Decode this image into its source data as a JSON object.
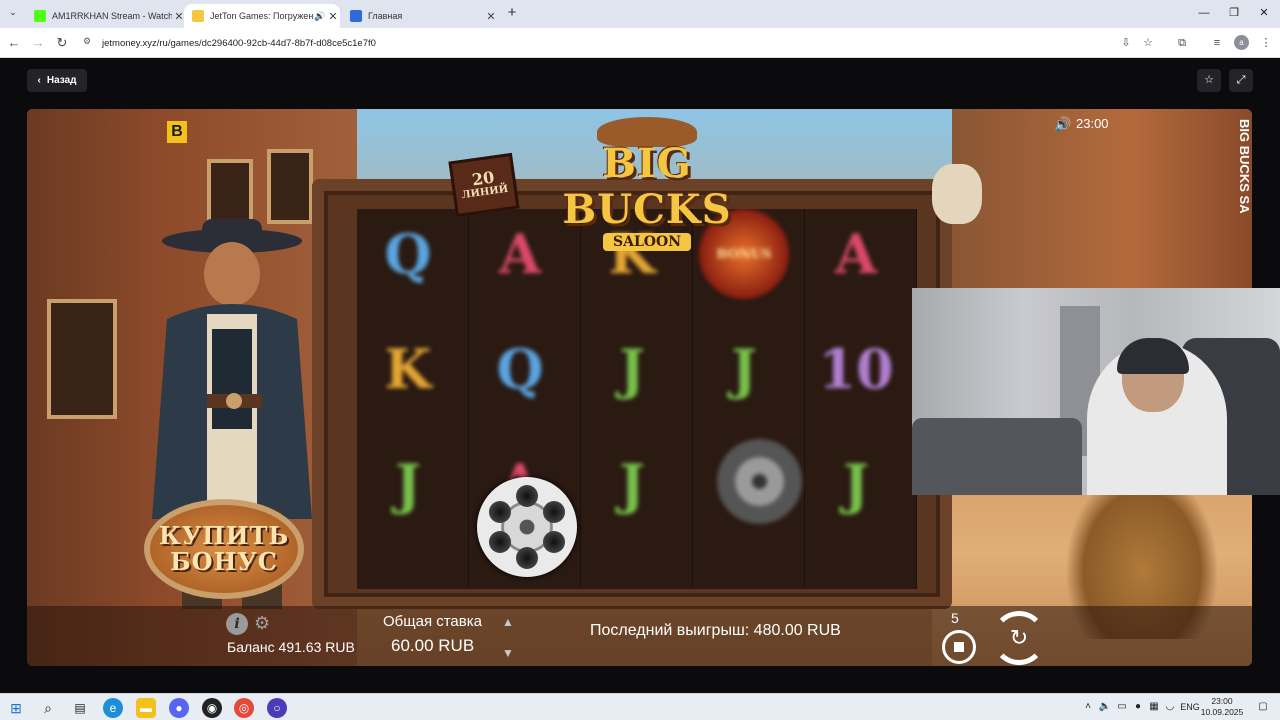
{
  "browser": {
    "tabs": [
      {
        "label": "AM1RRKHAN Stream - Watch l",
        "favicon": "kick-icon",
        "color": "#1a1a1a"
      },
      {
        "label": "JetTon Games: Погружени",
        "favicon": "jetton-icon",
        "color": "#4a8f1f"
      },
      {
        "label": "Главная",
        "favicon": "app-icon",
        "color": "#2e6bd8"
      }
    ],
    "url": "jetmoney.xyz/ru/games/dc296400-92cb-44d7-8b7f-d08ce5c1e7f0",
    "profile_initial": "a"
  },
  "page": {
    "back_label": "Назад",
    "favorite_icon": "star-icon",
    "fullscreen_icon": "expand-icon"
  },
  "game": {
    "provider_logo": "B",
    "title_main": "BIG BUCKS",
    "title_sub": "SALOON",
    "side_title": "BIG BUCKS SA",
    "lines_count": "20",
    "lines_word": "ЛИНИЙ",
    "buy_bonus_line1": "КУПИТЬ",
    "buy_bonus_line2": "БОНУС",
    "clock": "23:00",
    "reel_symbols": [
      [
        "Q",
        "K",
        "J"
      ],
      [
        "A",
        "Q",
        "A"
      ],
      [
        "K",
        "J",
        "J"
      ],
      [
        "BONUS",
        "J",
        "GUN"
      ],
      [
        "A",
        "10",
        "J"
      ]
    ],
    "balance": "Баланс 491.63 RUB",
    "bet_label": "Общая ставка",
    "bet_value": "60.00 RUB",
    "last_win": "Последний выигрыш: 480.00 RUB",
    "auto_spins_left": "5",
    "colors": {
      "gold": "#f5c642",
      "wood": "#5a3520"
    }
  },
  "taskbar": {
    "tray_lang": "ENG",
    "time": "23:00",
    "date": "10.09.2025"
  }
}
